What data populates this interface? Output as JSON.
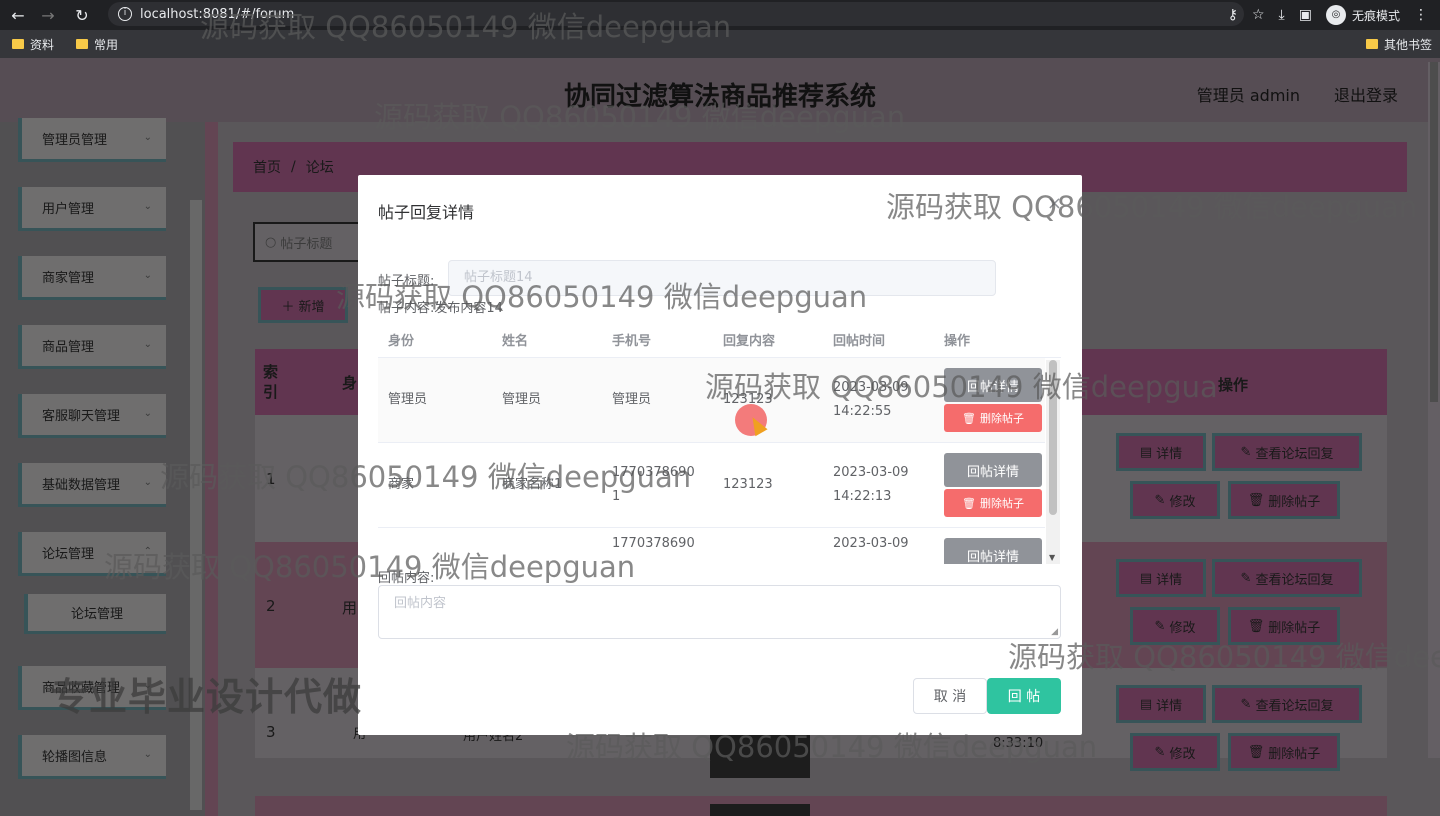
{
  "browser": {
    "url": "localhost:8081/#/forum",
    "incognito_label": "无痕模式",
    "bookmarks": [
      "资料",
      "常用"
    ],
    "other_bookmarks": "其他书签"
  },
  "header": {
    "title": "协同过滤算法商品推荐系统",
    "user": "管理员 admin",
    "logout": "退出登录"
  },
  "sidebar": {
    "items": [
      "管理员管理",
      "用户管理",
      "商家管理",
      "商品管理",
      "客服聊天管理",
      "基础数据管理",
      "论坛管理"
    ],
    "sub_item": "论坛管理",
    "items_lower": [
      "商品收藏管理",
      "轮播图信息"
    ]
  },
  "breadcrumb": {
    "home": "首页",
    "sep": "/",
    "current": "论坛"
  },
  "toolbar": {
    "search_placeholder": "帖子标题",
    "add_label": "新增"
  },
  "main_table": {
    "col_index": "索引",
    "col_ident": "身",
    "col_op": "操作",
    "rows": [
      {
        "num": "1",
        "frag": ""
      },
      {
        "num": "2",
        "frag": "用"
      },
      {
        "num": "3",
        "frag": "用",
        "name_frag": "用户姓名2",
        "time_frag": "8:33:10"
      }
    ],
    "ops": {
      "detail": "详情",
      "view_reply": "查看论坛回复",
      "edit": "修改",
      "delete": "删除帖子"
    }
  },
  "dialog": {
    "title": "帖子回复详情",
    "post_title_label": "帖子标题:",
    "post_title_value": "帖子标题14",
    "post_content_label": "帖子内容:",
    "post_content_value": "发布内容14",
    "columns": [
      "身份",
      "姓名",
      "手机号",
      "回复内容",
      "回帖时间",
      "操作"
    ],
    "rows": [
      {
        "identity": "管理员",
        "name": "管理员",
        "phone": "管理员",
        "content": "123123",
        "date": "2023-03-09",
        "time": "14:22:55"
      },
      {
        "identity": "商家",
        "name": "商家名称1",
        "phone": "17703786901",
        "content": "123123",
        "date": "2023-03-09",
        "time": "14:22:13"
      },
      {
        "identity": "",
        "name": "",
        "phone": "1770378690",
        "content": "",
        "date": "2023-03-09",
        "time": ""
      }
    ],
    "btn_reply_detail": "回帖详情",
    "btn_delete": "删除帖子",
    "reply_label": "回帖内容:",
    "reply_placeholder": "回帖内容",
    "cancel": "取 消",
    "submit": "回 帖"
  },
  "watermarks": {
    "text": "源码获取 QQ86050149 微信deepguan",
    "text_cut": "源码获取 QQ86050149 微信deepgua",
    "text_cut2": "源码获取 QQ86050149 微信dee",
    "big": "专业毕业设计代做"
  }
}
